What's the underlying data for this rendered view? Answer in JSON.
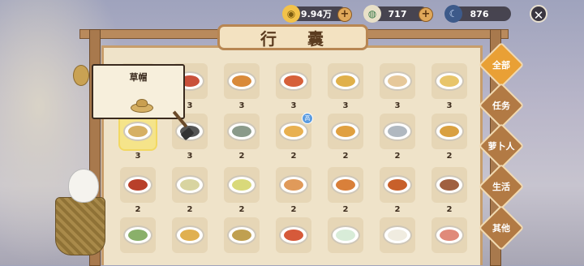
{
  "currency": {
    "coins": "9.94万",
    "gems": "717",
    "moon": "876"
  },
  "title": "行囊",
  "tooltip": {
    "item_name": "草帽"
  },
  "tabs": [
    {
      "label": "全部",
      "active": true
    },
    {
      "label": "任务",
      "active": false
    },
    {
      "label": "萝卜人",
      "active": false
    },
    {
      "label": "生活",
      "active": false
    },
    {
      "label": "其他",
      "active": false
    }
  ],
  "new_badge": "高",
  "grid": [
    [
      {
        "count": "3",
        "food": "#c9a05a"
      },
      {
        "count": "3",
        "food": "#c9503a"
      },
      {
        "count": "3",
        "food": "#d98a3a"
      },
      {
        "count": "3",
        "food": "#d6603a"
      },
      {
        "count": "3",
        "food": "#e0b04a"
      },
      {
        "count": "3",
        "food": "#e6c89a"
      },
      {
        "count": "3",
        "food": "#e8c56a"
      }
    ],
    [
      {
        "count": "3",
        "food": "#d6b064"
      },
      {
        "count": "3",
        "food": "#555555"
      },
      {
        "count": "2",
        "food": "#8a9a8a"
      },
      {
        "count": "2",
        "food": "#e8b050"
      },
      {
        "count": "2",
        "food": "#e0a040"
      },
      {
        "count": "2",
        "food": "#b0b8c0"
      },
      {
        "count": "2",
        "food": "#d9a040"
      }
    ],
    [
      {
        "count": "2",
        "food": "#b8402a"
      },
      {
        "count": "2",
        "food": "#d8d4a0"
      },
      {
        "count": "2",
        "food": "#d9d97a"
      },
      {
        "count": "2",
        "food": "#e09a5a"
      },
      {
        "count": "2",
        "food": "#d9803a"
      },
      {
        "count": "2",
        "food": "#c8602a"
      },
      {
        "count": "2",
        "food": "#a06040"
      }
    ],
    [
      {
        "count": "",
        "food": "#8ab06a"
      },
      {
        "count": "",
        "food": "#e0b050"
      },
      {
        "count": "",
        "food": "#c0a050"
      },
      {
        "count": "",
        "food": "#d65a3a"
      },
      {
        "count": "",
        "food": "#d8ecd8"
      },
      {
        "count": "",
        "food": "#f0ece0"
      },
      {
        "count": "",
        "food": "#e08a7a"
      }
    ]
  ]
}
